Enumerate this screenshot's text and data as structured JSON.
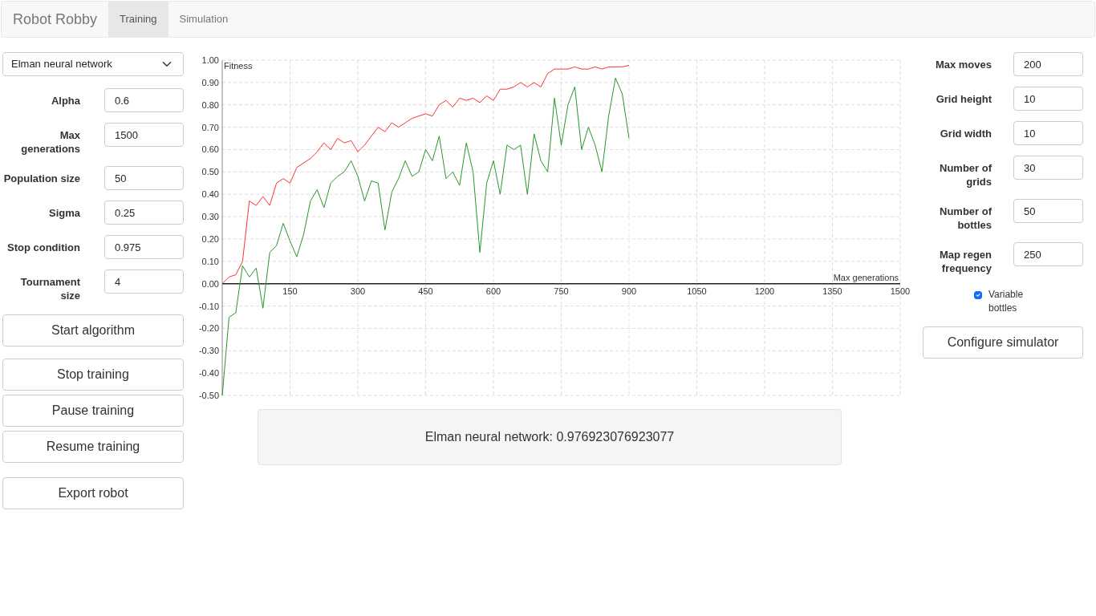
{
  "navbar": {
    "brand": "Robot Robby",
    "tabs": [
      {
        "label": "Training",
        "selected": true
      },
      {
        "label": "Simulation",
        "selected": false
      }
    ]
  },
  "algorithm_select": {
    "value": "Elman neural network"
  },
  "training_params": [
    {
      "label": "Alpha",
      "value": "0.6"
    },
    {
      "label": "Max generations",
      "value": "1500"
    },
    {
      "label": "Population size",
      "value": "50"
    },
    {
      "label": "Sigma",
      "value": "0.25"
    },
    {
      "label": "Stop condition",
      "value": "0.975"
    },
    {
      "label": "Tournament size",
      "value": "4"
    }
  ],
  "start_button": "Start algorithm",
  "training_buttons": [
    "Stop training",
    "Pause training",
    "Resume training"
  ],
  "export_button": "Export robot",
  "chart": {
    "chart_data": {
      "type": "line",
      "xlabel": "Max generations",
      "ylabel": "Fitness",
      "grid": true,
      "xlim": [
        0,
        1500
      ],
      "ylim": [
        -0.5,
        1.0
      ],
      "xticks": [
        150,
        300,
        450,
        600,
        750,
        900,
        1050,
        1200,
        1350,
        1500
      ],
      "yticks": [
        {
          "value": 1.0,
          "label": "1.00"
        },
        {
          "value": 0.9,
          "label": "0.90"
        },
        {
          "value": 0.8,
          "label": "0.80"
        },
        {
          "value": 0.7,
          "label": "0.70"
        },
        {
          "value": 0.6,
          "label": "0.60"
        },
        {
          "value": 0.5,
          "label": "0.50"
        },
        {
          "value": 0.4,
          "label": "0.40"
        },
        {
          "value": 0.3,
          "label": "0.30"
        },
        {
          "value": 0.2,
          "label": "0.20"
        },
        {
          "value": 0.1,
          "label": "0.10"
        },
        {
          "value": 0.0,
          "label": "0.00"
        },
        {
          "value": -0.1,
          "label": "-0.10"
        },
        {
          "value": -0.2,
          "label": "-0.20"
        },
        {
          "value": -0.3,
          "label": "-0.30"
        },
        {
          "value": -0.4,
          "label": "-0.40"
        },
        {
          "value": -0.5,
          "label": "-0.50"
        }
      ],
      "x": [
        0,
        15,
        30,
        45,
        60,
        75,
        90,
        105,
        120,
        135,
        150,
        165,
        180,
        195,
        210,
        225,
        240,
        255,
        270,
        285,
        300,
        315,
        330,
        345,
        360,
        375,
        390,
        405,
        420,
        435,
        450,
        465,
        480,
        495,
        510,
        525,
        540,
        555,
        570,
        585,
        600,
        615,
        630,
        645,
        660,
        675,
        690,
        705,
        720,
        735,
        750,
        765,
        780,
        795,
        810,
        825,
        840,
        855,
        870,
        885,
        900
      ],
      "series": [
        {
          "color": "#ff3030",
          "values": [
            0.0,
            0.03,
            0.04,
            0.1,
            0.37,
            0.35,
            0.39,
            0.35,
            0.45,
            0.47,
            0.45,
            0.52,
            0.54,
            0.56,
            0.59,
            0.63,
            0.6,
            0.65,
            0.63,
            0.64,
            0.59,
            0.62,
            0.66,
            0.7,
            0.68,
            0.72,
            0.7,
            0.72,
            0.74,
            0.75,
            0.76,
            0.75,
            0.8,
            0.82,
            0.79,
            0.83,
            0.82,
            0.83,
            0.81,
            0.84,
            0.82,
            0.87,
            0.87,
            0.88,
            0.9,
            0.88,
            0.9,
            0.88,
            0.94,
            0.96,
            0.96,
            0.96,
            0.97,
            0.96,
            0.96,
            0.97,
            0.96,
            0.97,
            0.97,
            0.97,
            0.977
          ]
        },
        {
          "color": "#2a962a",
          "values": [
            -0.5,
            -0.15,
            -0.13,
            0.08,
            0.03,
            0.07,
            -0.11,
            0.14,
            0.17,
            0.27,
            0.19,
            0.12,
            0.22,
            0.37,
            0.42,
            0.34,
            0.45,
            0.48,
            0.5,
            0.55,
            0.48,
            0.37,
            0.46,
            0.45,
            0.24,
            0.41,
            0.47,
            0.55,
            0.48,
            0.5,
            0.6,
            0.55,
            0.66,
            0.47,
            0.5,
            0.44,
            0.63,
            0.5,
            0.14,
            0.45,
            0.55,
            0.4,
            0.62,
            0.6,
            0.62,
            0.4,
            0.67,
            0.55,
            0.5,
            0.83,
            0.62,
            0.8,
            0.88,
            0.6,
            0.7,
            0.62,
            0.5,
            0.75,
            0.92,
            0.85,
            0.65
          ]
        }
      ]
    }
  },
  "result": "Elman neural network: 0.976923076923077",
  "simulator_params": [
    {
      "label": "Max moves",
      "value": "200"
    },
    {
      "label": "Grid height",
      "value": "10"
    },
    {
      "label": "Grid width",
      "value": "10"
    },
    {
      "label": "Number of grids",
      "value": "30"
    },
    {
      "label": "Number of bottles",
      "value": "50"
    },
    {
      "label": "Map regen frequency",
      "value": "250"
    }
  ],
  "variable_bottles": {
    "label": "Variable bottles",
    "checked": true
  },
  "configure_button": "Configure simulator"
}
